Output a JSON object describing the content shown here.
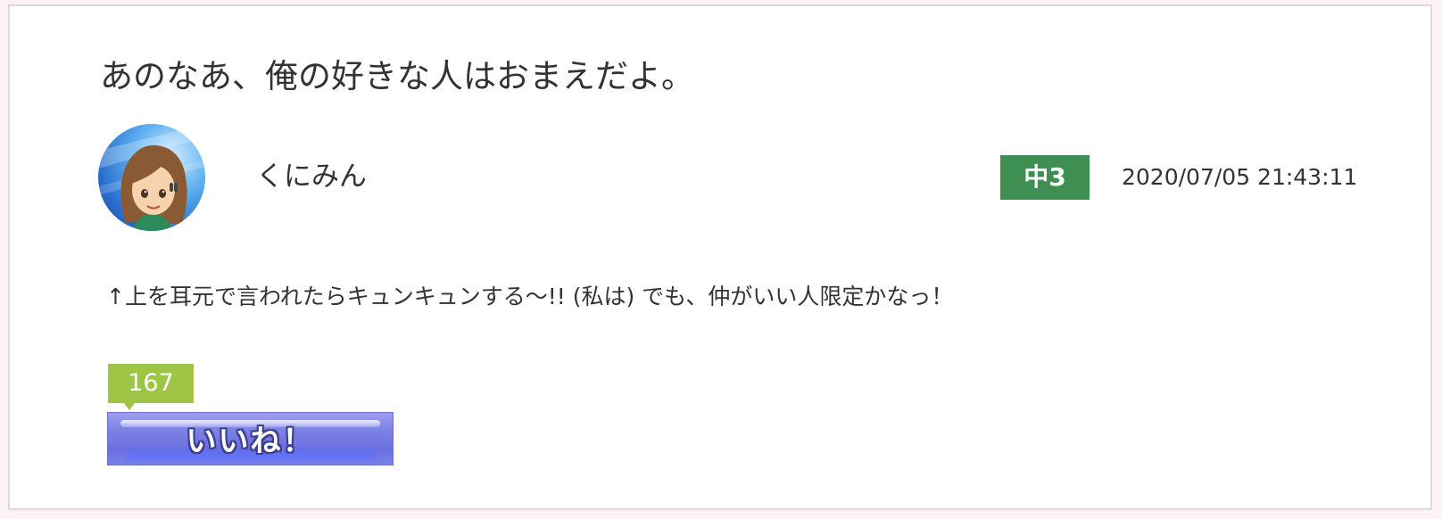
{
  "post": {
    "title": "あのなあ、俺の好きな人はおまえだよ。",
    "author": {
      "name": "くにみん",
      "avatar_icon": "user-avatar-girl"
    },
    "grade": {
      "label": "中3",
      "color": "#3f8f53"
    },
    "timestamp": "2020/07/05 21:43:11",
    "body": "↑上を耳元で言われたらキュンキュンする〜!! (私は) でも、仲がいい人限定かなっ！",
    "like": {
      "count": "167",
      "button_label": "いいね！",
      "count_color": "#9ec545",
      "button_color": "#7f84e6"
    }
  }
}
